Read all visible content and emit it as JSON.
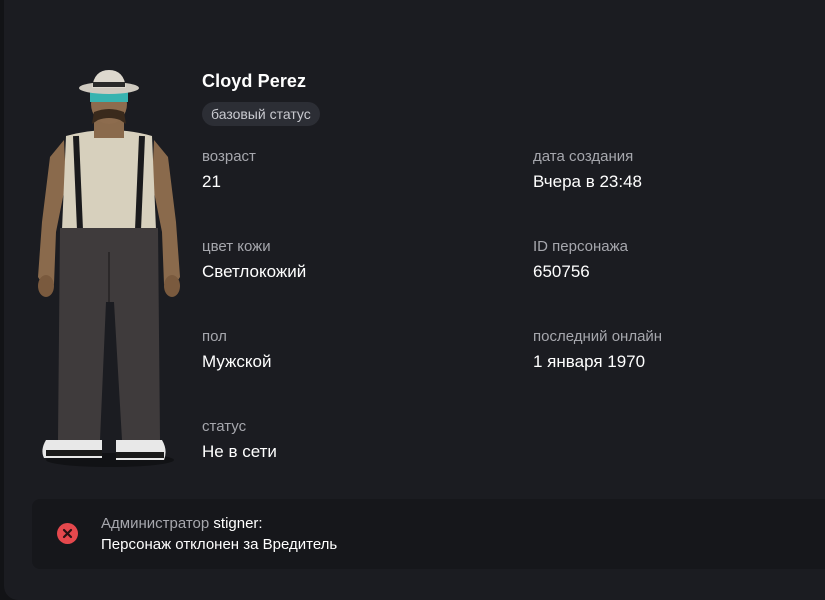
{
  "character": {
    "name": "Cloyd Perez",
    "status_badge": "базовый статус",
    "avatar_icon": "character-skin-image"
  },
  "fields": {
    "age": {
      "label": "возраст",
      "value": "21"
    },
    "created": {
      "label": "дата создания",
      "value": "Вчера в 23:48"
    },
    "skin": {
      "label": "цвет кожи",
      "value": "Светлокожий"
    },
    "id": {
      "label": "ID персонажа",
      "value": "650756"
    },
    "gender": {
      "label": "пол",
      "value": "Мужской"
    },
    "last_online": {
      "label": "последний онлайн",
      "value": "1 января 1970"
    },
    "status": {
      "label": "статус",
      "value": "Не в сети"
    }
  },
  "notice": {
    "author_role": "Администратор",
    "author_name": "stigner:",
    "message": "Персонаж отклонен за Вредитель",
    "icon": "error-x-circle-icon",
    "icon_color": "#e5484d"
  },
  "colors": {
    "background": "#121316",
    "panel": "#1b1c21",
    "badge": "#2c2e35",
    "label": "#a6a7ad",
    "value": "#ffffff"
  }
}
